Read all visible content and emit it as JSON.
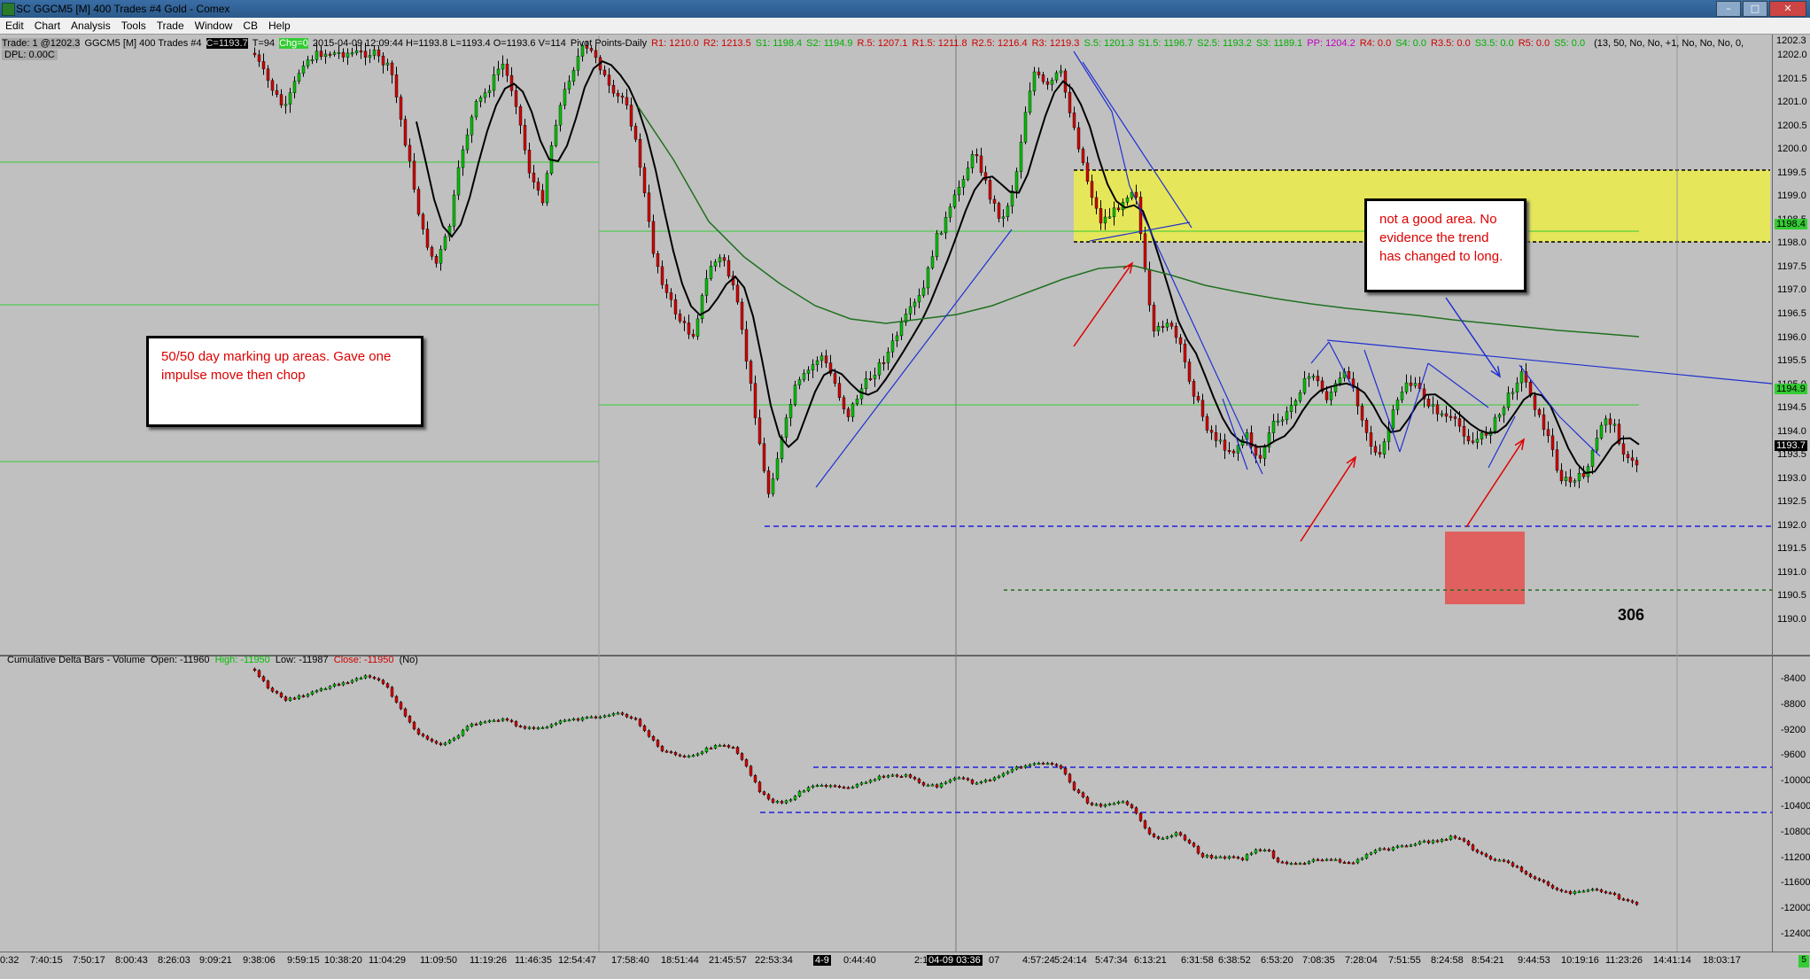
{
  "window": {
    "title": "SC GGCM5 [M]  400 Trades  #4  Gold - Comex"
  },
  "menu": [
    "Edit",
    "Chart",
    "Analysis",
    "Tools",
    "Trade",
    "Window",
    "CB",
    "Help"
  ],
  "info_bar": {
    "trade": "Trade: 1 @1202.3",
    "symbol": "GGCM5 [M]  400 Trades  #4",
    "last_value": "C=1193.7",
    "t_value": "T=94",
    "chg": "Chg=0",
    "stats": "2015-04-09 12:09:44 H=1193.8 L=1193.4 O=1193.6 V=114",
    "pivot_title": "Pivot Points-Daily",
    "pivots": [
      {
        "text": "R1: 1210.0",
        "color": "#d00000"
      },
      {
        "text": "R2: 1213.5",
        "color": "#d00000"
      },
      {
        "text": "S1: 1198.4",
        "color": "#00b000"
      },
      {
        "text": "S2: 1194.9",
        "color": "#00b000"
      },
      {
        "text": "R.5: 1207.1",
        "color": "#d00000"
      },
      {
        "text": "R1.5: 1211.8",
        "color": "#d00000"
      },
      {
        "text": "R2.5: 1216.4",
        "color": "#d00000"
      },
      {
        "text": "R3: 1219.3",
        "color": "#d00000"
      },
      {
        "text": "S.5: 1201.3",
        "color": "#00b000"
      },
      {
        "text": "S1.5: 1196.7",
        "color": "#00b000"
      },
      {
        "text": "S2.5: 1193.2",
        "color": "#00b000"
      },
      {
        "text": "S3: 1189.1",
        "color": "#00b000"
      },
      {
        "text": "PP: 1204.2",
        "color": "#c000c0"
      },
      {
        "text": "R4: 0.0",
        "color": "#d00000"
      },
      {
        "text": "S4: 0.0",
        "color": "#00b000"
      },
      {
        "text": "R3.5: 0.0",
        "color": "#d00000"
      },
      {
        "text": "S3.5: 0.0",
        "color": "#00b000"
      },
      {
        "text": "R5: 0.0",
        "color": "#d00000"
      },
      {
        "text": "S5: 0.0",
        "color": "#00b000"
      }
    ],
    "settings": "(13, 50, No, No, +1, No, No, No, 0,"
  },
  "dpl": "DPL: 0.00C",
  "price_axis": {
    "labels": [
      "1202.0",
      "1201.5",
      "1201.0",
      "1200.5",
      "1200.0",
      "1199.5",
      "1199.0",
      "1198.5",
      "1198.0",
      "1197.5",
      "1197.0",
      "1196.5",
      "1196.0",
      "1195.5",
      "1195.0",
      "1194.5",
      "1194.0",
      "1193.5",
      "1193.0",
      "1192.5",
      "1192.0",
      "1191.5",
      "1191.0",
      "1190.5",
      "1190.0"
    ],
    "top_tag": "1202.3",
    "tags": [
      {
        "text": "1198.4",
        "bg": "#33cc33"
      },
      {
        "text": "1194.9",
        "bg": "#33cc33"
      },
      {
        "text": "1193.7",
        "bg": "#000000",
        "fg": "#ffffff"
      }
    ]
  },
  "lower_panel": {
    "title": "Cumulative Delta Bars - Volume",
    "open": "Open: -11960",
    "high": "High: -11950",
    "low": "Low: -11987",
    "close": "Close: -11950",
    "flag": "(No)",
    "axis_labels": [
      "-8400",
      "-8800",
      "-9200",
      "-9600",
      "-10000",
      "-10400",
      "-10800",
      "-11200",
      "-11600",
      "-12000",
      "-12400"
    ]
  },
  "time_axis": [
    {
      "text": "0:32"
    },
    {
      "text": "7:40:15"
    },
    {
      "text": "7:50:17"
    },
    {
      "text": "8:00:43"
    },
    {
      "text": "8:26:03"
    },
    {
      "text": "9:09:21"
    },
    {
      "text": "9:38:06"
    },
    {
      "text": "9:59:15"
    },
    {
      "text": "10:38:20"
    },
    {
      "text": "11:04:29"
    },
    {
      "text": "11:09:50"
    },
    {
      "text": "11:19:26"
    },
    {
      "text": "11:46:35"
    },
    {
      "text": "12:54:47"
    },
    {
      "text": "17:58:40"
    },
    {
      "text": "18:51:44"
    },
    {
      "text": "21:45:57"
    },
    {
      "text": "22:53:34"
    },
    {
      "text": "4-9",
      "hl": true
    },
    {
      "text": "0:44:40"
    },
    {
      "text": "2:16:43"
    },
    {
      "text": "04-09 03:36",
      "hl": true
    },
    {
      "text": "07"
    },
    {
      "text": "4:57:24"
    },
    {
      "text": "5:24:14"
    },
    {
      "text": "5:47:34"
    },
    {
      "text": "6:13:21"
    },
    {
      "text": "6:31:58"
    },
    {
      "text": "6:38:52"
    },
    {
      "text": "6:53:20"
    },
    {
      "text": "7:08:35"
    },
    {
      "text": "7:28:04"
    },
    {
      "text": "7:51:55"
    },
    {
      "text": "8:24:58"
    },
    {
      "text": "8:54:21"
    },
    {
      "text": "9:44:53"
    },
    {
      "text": "10:19:16"
    },
    {
      "text": "11:23:26"
    },
    {
      "text": "14:41:14"
    },
    {
      "text": "18:03:17"
    }
  ],
  "notes": {
    "left": "50/50 day marking up areas. Gave one impulse move then chop",
    "right": "not a good area.  No evidence the trend has changed to long."
  },
  "count_label": "306",
  "corner_label": "5",
  "colors": {
    "up_candle": "#00c000",
    "down_candle": "#d00000",
    "zone": "#e6e65a",
    "red_box": "#e06060",
    "trendline": "#2030d0",
    "annot_arrow": "#e00000",
    "ma_black": "#000000",
    "ma_green": "#207020"
  }
}
